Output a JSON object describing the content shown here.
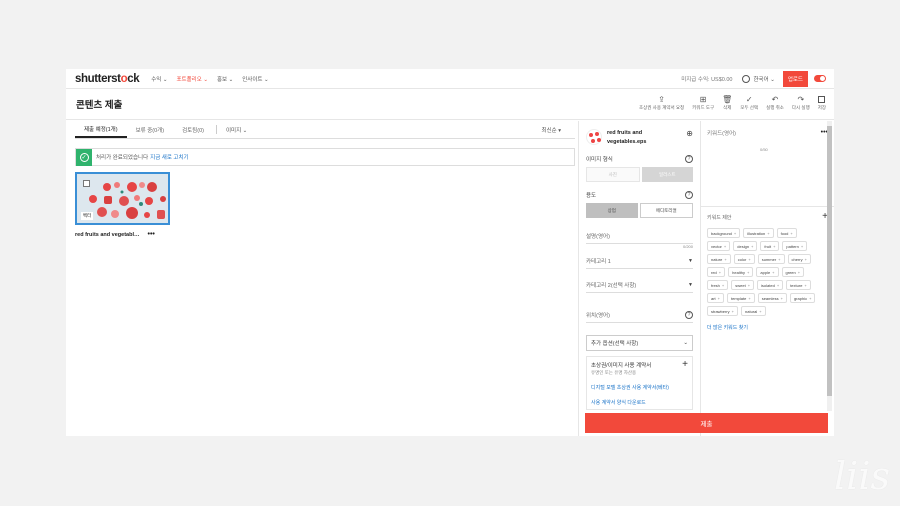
{
  "topnav": {
    "logo_a": "shutterst",
    "logo_b": "o",
    "logo_c": "ck",
    "items": [
      "수익 ⌄",
      "포트폴리오 ⌄",
      "홍보 ⌄",
      "인사이트 ⌄"
    ],
    "earnings": "미지급 수익: US$0.00",
    "language": "한국어 ⌄",
    "upload": "업로드"
  },
  "header": {
    "title": "콘텐츠 제출",
    "tools": [
      {
        "label": "초상권 사용 계약서 요청",
        "icon": "person-upload-icon",
        "glyph": "⇪"
      },
      {
        "label": "키워드 도구",
        "icon": "keyword-tool-icon",
        "glyph": "⊞"
      },
      {
        "label": "삭제",
        "icon": "trash-icon",
        "glyph": "🗑"
      },
      {
        "label": "모두 선택",
        "icon": "check-icon",
        "glyph": "✓"
      },
      {
        "label": "실행 취소",
        "icon": "undo-icon",
        "glyph": "↶"
      },
      {
        "label": "다시 실행",
        "icon": "redo-icon",
        "glyph": "↷"
      },
      {
        "label": "저장",
        "icon": "save-icon",
        "glyph": ""
      }
    ]
  },
  "left": {
    "tabs": [
      "제출 예정(1개)",
      "보류 중(0개)",
      "검토됨(0)"
    ],
    "type_select": "이미지 ⌄",
    "sort": "최신순 ▾",
    "notice_text": "처리가 완료되었습니다",
    "notice_link": "지금 새로 고치기",
    "thumb_badge": "벡터",
    "thumb_name": "red fruits and vegetabl…",
    "thumb_more": "•••"
  },
  "form": {
    "file_title": "red fruits and vegetables.eps",
    "image_type_label": "이미지 형식",
    "image_type_options": [
      "사진",
      "일러스트"
    ],
    "usage_label": "용도",
    "usage_options": [
      "상업",
      "에디토리얼"
    ],
    "description_placeholder": "설명(영어)",
    "description_counter": "0/200",
    "category1": "카테고리 1",
    "category2": "카테고리 2(선택 사항)",
    "location_placeholder": "위치(영어)",
    "extra_options": "추가 옵션(선택 사항)",
    "release_title": "초상권/이미지 사용 계약서",
    "release_sub": "유명인 또는 유명 자산용",
    "release_link1": "디지털 모델 초상권 사용 계약서(베타)",
    "release_link2": "사용 계약서 양식 다운로드"
  },
  "keywords": {
    "placeholder": "키워드(영어)",
    "count": "0/50",
    "suggest_label": "키워드 제안",
    "chips": [
      "background",
      "illustration",
      "food",
      "vector",
      "design",
      "fruit",
      "pattern",
      "nature",
      "color",
      "summer",
      "cherry",
      "red",
      "healthy",
      "apple",
      "green",
      "fresh",
      "sweet",
      "isolated",
      "texture",
      "art",
      "template",
      "seamless",
      "graphic",
      "strawberry",
      "natural"
    ],
    "more_link": "더 많은 키워드 찾기"
  },
  "submit_label": "제출",
  "colors": {
    "accent": "#f2493b",
    "link": "#1a73c8",
    "success": "#2fb36d",
    "selected_border": "#3a8fd6"
  }
}
